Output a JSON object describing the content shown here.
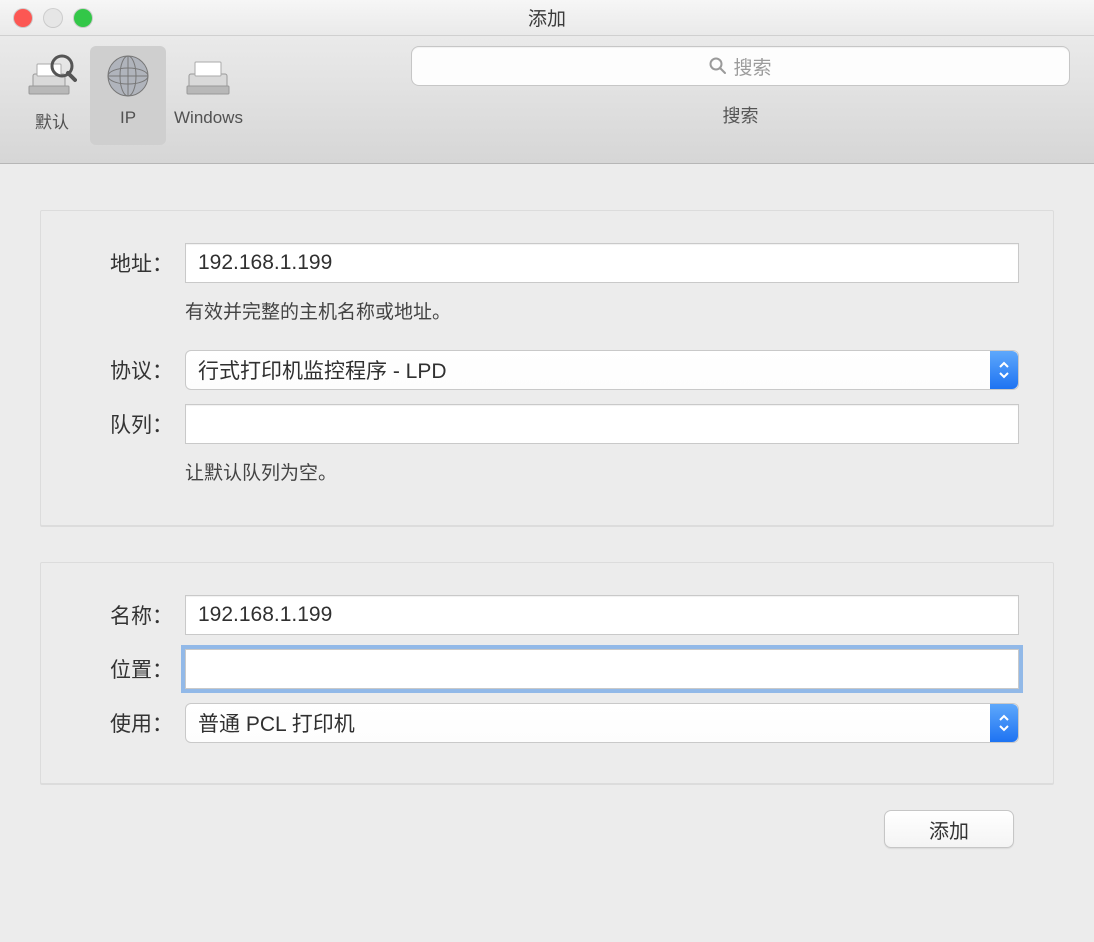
{
  "window": {
    "title": "添加"
  },
  "toolbar": {
    "items": [
      {
        "label": "默认",
        "selected": false
      },
      {
        "label": "IP",
        "selected": true
      },
      {
        "label": "Windows",
        "selected": false
      }
    ],
    "search_placeholder": "搜索",
    "search_label": "搜索"
  },
  "panel1": {
    "address_label": "地址：",
    "address_value": "192.168.1.199",
    "address_helper": "有效并完整的主机名称或地址。",
    "protocol_label": "协议：",
    "protocol_value": "行式打印机监控程序 - LPD",
    "queue_label": "队列：",
    "queue_value": "",
    "queue_helper": "让默认队列为空。"
  },
  "panel2": {
    "name_label": "名称：",
    "name_value": "192.168.1.199",
    "location_label": "位置：",
    "location_value": "",
    "use_label": "使用：",
    "use_value": "普通 PCL 打印机"
  },
  "actions": {
    "add_label": "添加"
  }
}
